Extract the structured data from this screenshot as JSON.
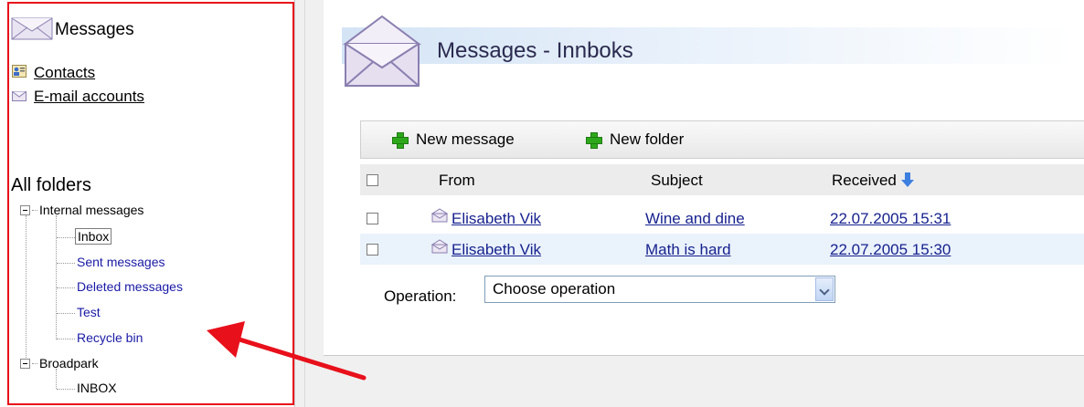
{
  "sidebar": {
    "title": "Messages",
    "links": [
      {
        "label": "Contacts"
      },
      {
        "label": "E-mail accounts"
      }
    ],
    "folders_heading": "All folders",
    "tree": [
      {
        "label": "Internal messages",
        "children": [
          "Inbox",
          "Sent messages",
          "Deleted messages",
          "Test",
          "Recycle bin"
        ]
      },
      {
        "label": "Broadpark",
        "children": [
          "INBOX"
        ]
      }
    ]
  },
  "main": {
    "page_title": "Messages - Innboks",
    "toolbar": {
      "new_message": "New message",
      "new_folder": "New folder"
    },
    "grid": {
      "columns": {
        "from": "From",
        "subject": "Subject",
        "received": "Received"
      },
      "rows": [
        {
          "from": "Elisabeth Vik",
          "subject": "Wine and dine",
          "received": "22.07.2005 15:31"
        },
        {
          "from": "Elisabeth Vik",
          "subject": "Math is hard",
          "received": "22.07.2005 15:30"
        }
      ]
    },
    "operation": {
      "label": "Operation:",
      "selected": "Choose operation"
    }
  },
  "icons": {
    "title": "envelope-icon",
    "contacts": "contact-card-icon",
    "email_accounts": "envelope-icon",
    "add": "green-plus-icon",
    "sort": "sort-down-arrow-icon",
    "dropdown": "chevron-down-icon"
  },
  "colors": {
    "highlight_border": "#e8101b",
    "link": "#17228f",
    "tree_link": "#1a1aa6",
    "alt_row": "#eaf2fb",
    "add_icon": "#2ea81b",
    "sort_icon": "#3c7fe0"
  }
}
